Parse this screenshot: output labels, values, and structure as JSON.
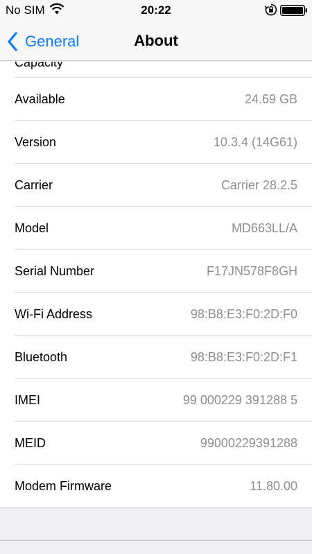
{
  "status_bar": {
    "carrier": "No SIM",
    "time": "20:22"
  },
  "nav": {
    "back_label": "General",
    "title": "About"
  },
  "rows": [
    {
      "label": "Capacity",
      "value": ""
    },
    {
      "label": "Available",
      "value": "24.69 GB"
    },
    {
      "label": "Version",
      "value": "10.3.4 (14G61)"
    },
    {
      "label": "Carrier",
      "value": "Carrier 28.2.5"
    },
    {
      "label": "Model",
      "value": "MD663LL/A"
    },
    {
      "label": "Serial Number",
      "value": "F17JN578F8GH"
    },
    {
      "label": "Wi-Fi Address",
      "value": "98:B8:E3:F0:2D:F0"
    },
    {
      "label": "Bluetooth",
      "value": "98:B8:E3:F0:2D:F1"
    },
    {
      "label": "IMEI",
      "value": "99 000229 391288 5"
    },
    {
      "label": "MEID",
      "value": "99000229391288"
    },
    {
      "label": "Modem Firmware",
      "value": "11.80.00"
    }
  ],
  "colors": {
    "accent": "#0a7aff",
    "secondary_text": "#8e8e93",
    "background": "#efeff4"
  }
}
